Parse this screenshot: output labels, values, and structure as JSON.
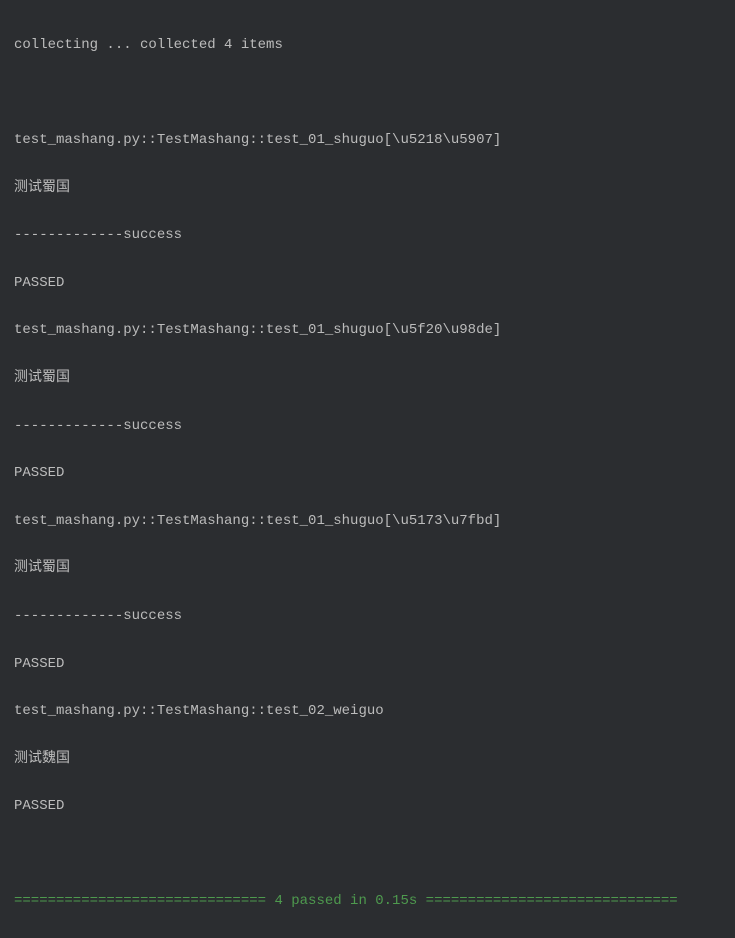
{
  "terminal": {
    "collecting": "collecting ... collected 4 items",
    "blank": "",
    "test1_header": "test_mashang.py::TestMashang::test_01_shuguo[\\u5218\\u5907]",
    "test1_desc": "测试蜀国",
    "test1_result": "-------------success",
    "test1_status": "PASSED",
    "test2_header": "test_mashang.py::TestMashang::test_01_shuguo[\\u5f20\\u98de]",
    "test2_desc": "测试蜀国",
    "test2_result": "-------------success",
    "test2_status": "PASSED",
    "test3_header": "test_mashang.py::TestMashang::test_01_shuguo[\\u5173\\u7fbd]",
    "test3_desc": "测试蜀国",
    "test3_result": "-------------success",
    "test3_status": "PASSED",
    "test4_header": "test_mashang.py::TestMashang::test_02_weiguo",
    "test4_desc": "测试魏国",
    "test4_status": "PASSED",
    "summary": "============================== 4 passed in 0.15s =============================="
  }
}
